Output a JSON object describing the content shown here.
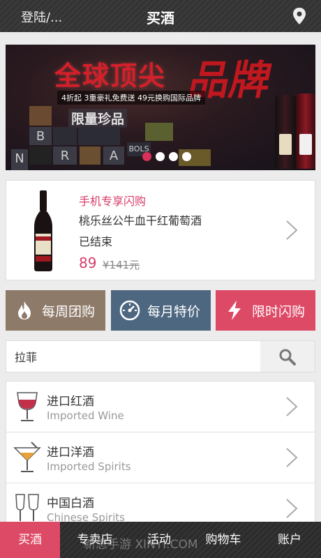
{
  "header": {
    "login_label": "登陆/...",
    "title": "买酒",
    "location_icon": "location-pin-icon"
  },
  "banner": {
    "title": "全球顶尖",
    "brush_text": "品牌",
    "subtitle": "4折起 3重豪礼免费送 49元换购国际品牌",
    "limited_label": "限量珍品",
    "tiles": [
      "B",
      "R",
      "A",
      "N",
      "BOLS"
    ],
    "slide_count": 4,
    "active_slide": 1
  },
  "flash_sale": {
    "tag": "手机专享闪购",
    "product_name": "桃乐丝公牛血干红葡萄酒",
    "status": "已结束",
    "price": "89",
    "original_price": "¥141元"
  },
  "categories": {
    "weekly_group": "每周团购",
    "monthly_special": "每月特价",
    "flash_buy": "限时闪购"
  },
  "search": {
    "value": "拉菲",
    "icon": "search-icon"
  },
  "wine_types": [
    {
      "zh": "进口红酒",
      "en": "Imported Wine",
      "icon": "red-wine-glass-icon"
    },
    {
      "zh": "进口洋酒",
      "en": "Imported Spirits",
      "icon": "cocktail-glass-icon"
    },
    {
      "zh": "中国白酒",
      "en": "Chinese Spirits",
      "icon": "baijiu-glass-icon"
    }
  ],
  "tabbar": {
    "tabs": [
      "买酒",
      "专卖店",
      "活动",
      "购物车",
      "账户"
    ],
    "active": "买酒",
    "watermark": "新思手游 XINYI.COM"
  },
  "colors": {
    "accent": "#dd4a66",
    "weekly": "#8e7a69",
    "monthly": "#4e6780",
    "flash": "#dd4a66"
  }
}
